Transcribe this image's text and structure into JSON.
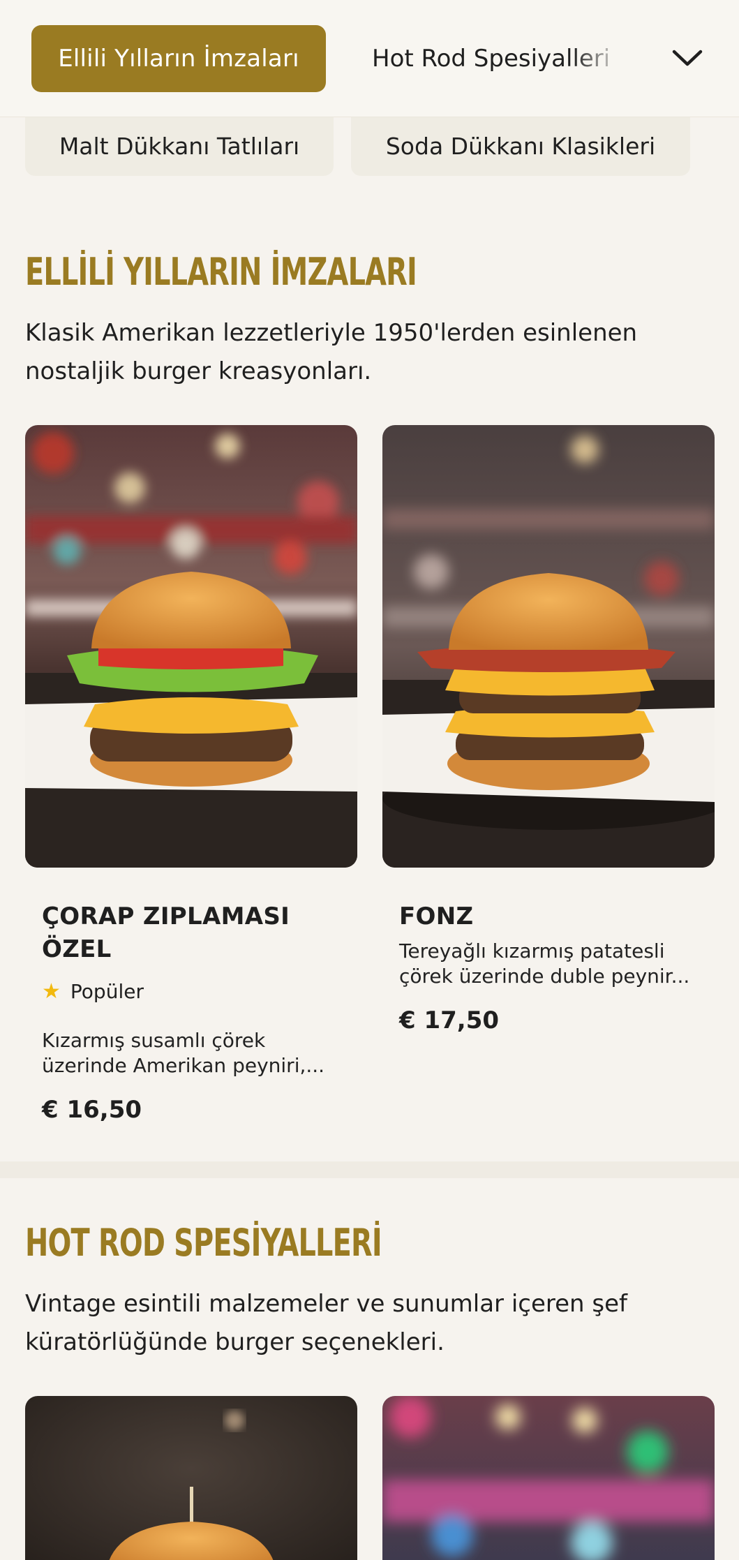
{
  "nav": {
    "active_tab": "Ellili Yılların İmzaları",
    "next_tab": "Hot Rod Spesiyalleri",
    "expand_icon": "chevron-down-icon",
    "chips": [
      "Malt Dükkanı Tatlıları",
      "Soda Dükkanı Klasikleri"
    ]
  },
  "sections": [
    {
      "title": "ELLİLİ YILLARIN İMZALARI",
      "description": "Klasik Amerikan lezzetleriyle 1950'lerden esinlenen nostaljik burger kreasyonları.",
      "items": [
        {
          "name": "ÇORAP ZIPLAMASI ÖZEL",
          "badge": "Popüler",
          "badge_icon": "star-icon",
          "description": "Kızarmış susamlı çörek üzerinde Amerikan peyniri,...",
          "price": "€ 16,50"
        },
        {
          "name": "FONZ",
          "description": "Tereyağlı kızarmış patatesli çörek üzerinde duble peynir...",
          "price": "€ 17,50"
        }
      ]
    },
    {
      "title": "HOT ROD SPESİYALLERİ",
      "description": "Vintage esintili malzemeler ve sunumlar içeren şef küratörlüğünde burger seçenekleri."
    }
  ],
  "colors": {
    "accent": "#9a7b22",
    "background": "#f6f3ee",
    "chip": "#efece3",
    "star": "#f2b90f"
  }
}
